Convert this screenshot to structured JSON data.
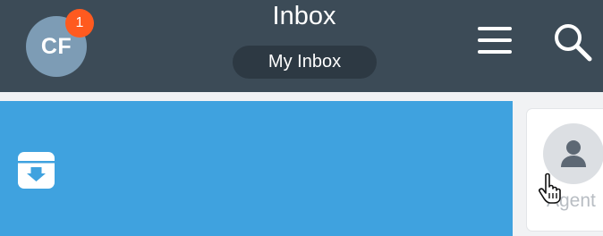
{
  "header": {
    "title": "Inbox",
    "inbox_selector": "My Inbox",
    "user_initials": "CF",
    "notification_count": "1"
  },
  "conversation": {
    "agent_label": "Agent"
  },
  "colors": {
    "header_bg": "#3c4b57",
    "swipe_action_bg": "#3fa2df",
    "badge": "#ff5a1f",
    "avatar_bg": "#7d9cb5"
  },
  "icons": {
    "menu": "hamburger-menu-icon",
    "search": "search-icon",
    "swipe_action": "archive-icon",
    "agent": "person-icon",
    "pointer": "hand-cursor-icon"
  }
}
